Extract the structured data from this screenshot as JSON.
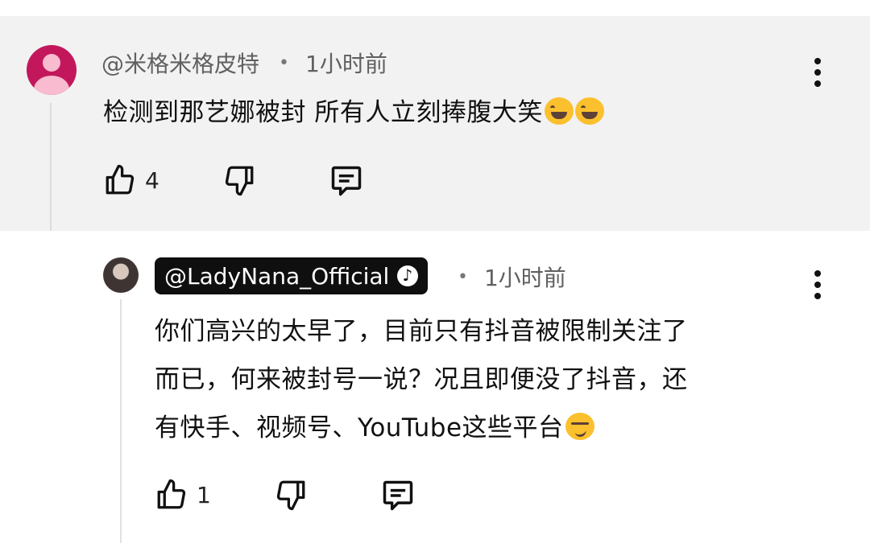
{
  "comment": {
    "author": "@米格米格皮特",
    "time": "1小时前",
    "text": "检测到那艺娜被封 所有人立刻捧腹大笑",
    "likes": "4"
  },
  "reply": {
    "author": "@LadyNana_Official",
    "time": "1小时前",
    "lines": [
      "你们高兴的太早了，目前只有抖音被限制关注了",
      "而已，何来被封号一说？况且即便没了抖音，还",
      "有快手、视频号、YouTube这些平台"
    ],
    "likes": "1"
  },
  "separator": "•",
  "icons": {
    "like": "thumbs-up-icon",
    "dislike": "thumbs-down-icon",
    "reply": "reply-comment-icon",
    "more": "more-vertical-icon",
    "verified": "music-note-verified-icon",
    "emoji_laugh": "tears-of-joy-emoji",
    "emoji_smirk": "smirk-emoji"
  },
  "colors": {
    "top_comment_bg": "#f2f2f2",
    "avatar": "#c2185b",
    "badge_bg": "#0f0f0f"
  }
}
